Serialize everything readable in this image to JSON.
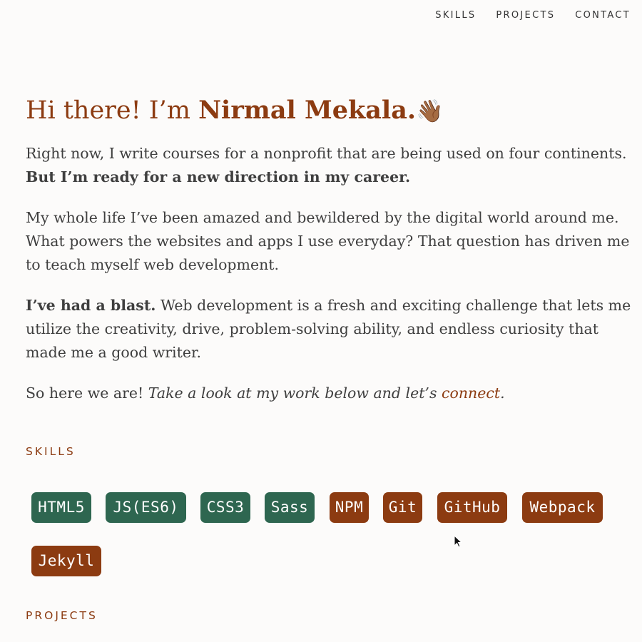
{
  "nav": {
    "items": [
      "SKILLS",
      "PROJECTS",
      "CONTACT"
    ]
  },
  "intro": {
    "greeting": "Hi there! I’m ",
    "name": "Nirmal Mekala.",
    "wave_emoji": "👋🏾"
  },
  "paragraphs": {
    "p1_text": "Right now, I write courses for a nonprofit that are being used on four continents. ",
    "p1_bold": "But I’m ready for a new direction in my career.",
    "p2_text": "My whole life I’ve been amazed and bewildered by the digital world around me. What powers the websites and apps I use everyday? That question has driven me to teach myself web development.",
    "p3_bold": "I’ve had a blast.",
    "p3_text": " Web development is a fresh and exciting challenge that lets me utilize the creativity, drive, problem-solving ability, and endless curiosity that made me a good writer.",
    "p4_text": "So here we are! ",
    "p4_italic": "Take a look at my work below and let’s ",
    "p4_link": "connect",
    "p4_end": "."
  },
  "sections": {
    "skills_label": "SKILLS",
    "projects_label": "PROJECTS"
  },
  "skills": [
    {
      "label": "HTML5",
      "color": "#2e6650"
    },
    {
      "label": "JS(ES6)",
      "color": "#2e6650"
    },
    {
      "label": "CSS3",
      "color": "#2e6650"
    },
    {
      "label": "Sass",
      "color": "#2e6650"
    },
    {
      "label": "NPM",
      "color": "#8c3b11"
    },
    {
      "label": "Git",
      "color": "#8c3b11"
    },
    {
      "label": "GitHub",
      "color": "#8c3b11"
    },
    {
      "label": "Webpack",
      "color": "#8c3b11"
    },
    {
      "label": "Jekyll",
      "color": "#8c3b11"
    }
  ]
}
